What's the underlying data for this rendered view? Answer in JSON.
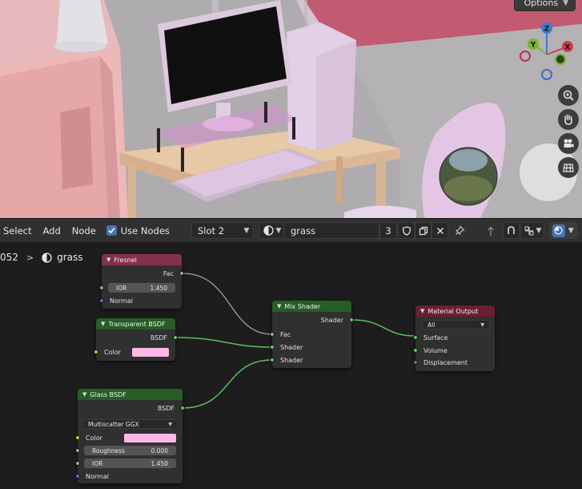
{
  "viewport": {
    "options_label": "Options",
    "gizmo": {
      "z": "Z",
      "y": "Y",
      "x": "X"
    },
    "nav_icons": [
      "zoom-icon",
      "pan-hand-icon",
      "camera-icon",
      "grid-icon"
    ]
  },
  "header": {
    "menu": [
      "Select",
      "Add",
      "Node"
    ],
    "use_nodes_label": "Use Nodes",
    "use_nodes_checked": true,
    "slot_label": "Slot 2",
    "material_name": "grass",
    "user_count": "3"
  },
  "breadcrumb": {
    "prefix": "052",
    "material": "grass"
  },
  "nodes": {
    "fresnel": {
      "title": "Fresnel",
      "out_fac": "Fac",
      "ior_label": "IOR",
      "ior_value": "1.450",
      "normal_label": "Normal"
    },
    "transparent": {
      "title": "Transparent BSDF",
      "out_bsdf": "BSDF",
      "color_label": "Color",
      "color": "#ffb8e6"
    },
    "glass": {
      "title": "Glass BSDF",
      "out_bsdf": "BSDF",
      "distribution": "Multiscatter GGX",
      "color_label": "Color",
      "color": "#ffb8e6",
      "roughness_label": "Roughness",
      "roughness_value": "0.000",
      "ior_label": "IOR",
      "ior_value": "1.450",
      "normal_label": "Normal"
    },
    "mix": {
      "title": "Mix Shader",
      "out_shader": "Shader",
      "in_fac": "Fac",
      "in_shader1": "Shader",
      "in_shader2": "Shader"
    },
    "output": {
      "title": "Material Output",
      "target": "All",
      "in_surface": "Surface",
      "in_volume": "Volume",
      "in_displacement": "Displacement"
    }
  },
  "colors": {
    "accent": "#4772b3",
    "input_node_header": "#83314a",
    "shader_node_header": "#275d26",
    "output_node_header": "#6b1f33",
    "shader_link": "#5fbf5f",
    "float_link": "#a1a1a1"
  }
}
